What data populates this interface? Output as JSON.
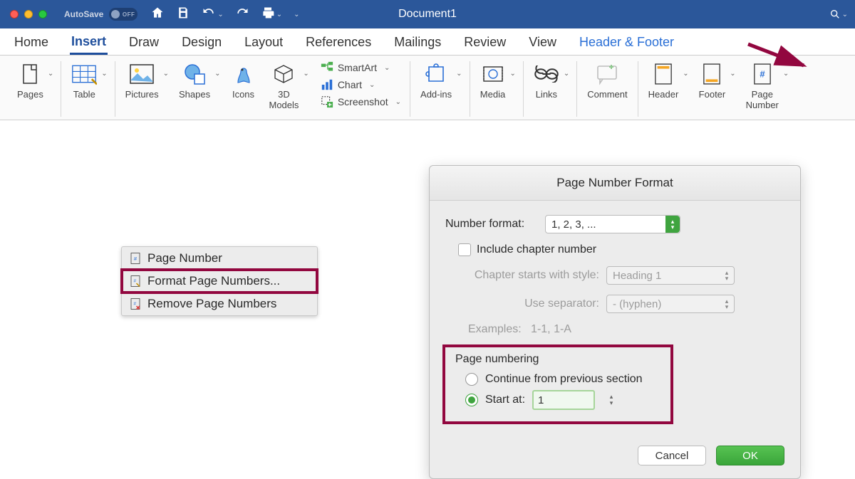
{
  "titlebar": {
    "autosave_label": "AutoSave",
    "autosave_state": "OFF",
    "document_title": "Document1"
  },
  "tabs": [
    "Home",
    "Insert",
    "Draw",
    "Design",
    "Layout",
    "References",
    "Mailings",
    "Review",
    "View",
    "Header & Footer"
  ],
  "active_tab": "Insert",
  "ribbon": {
    "pages": "Pages",
    "table": "Table",
    "pictures": "Pictures",
    "shapes": "Shapes",
    "icons": "Icons",
    "models": "3D\nModels",
    "smartart": "SmartArt",
    "chart": "Chart",
    "screenshot": "Screenshot",
    "addins": "Add-ins",
    "media": "Media",
    "links": "Links",
    "comment": "Comment",
    "header": "Header",
    "footer": "Footer",
    "page_number": "Page\nNumber"
  },
  "context_menu": {
    "page_number": "Page Number",
    "format": "Format Page Numbers...",
    "remove": "Remove Page Numbers"
  },
  "dialog": {
    "title": "Page Number Format",
    "number_format_label": "Number format:",
    "number_format_value": "1, 2, 3, ...",
    "include_chapter": "Include chapter number",
    "chapter_style_label": "Chapter starts with style:",
    "chapter_style_value": "Heading 1",
    "separator_label": "Use separator:",
    "separator_value": "-    (hyphen)",
    "examples_label": "Examples:",
    "examples_value": "1-1, 1-A",
    "page_numbering": "Page numbering",
    "continue_label": "Continue from previous section",
    "start_at_label": "Start at:",
    "start_at_value": "1",
    "cancel": "Cancel",
    "ok": "OK"
  }
}
